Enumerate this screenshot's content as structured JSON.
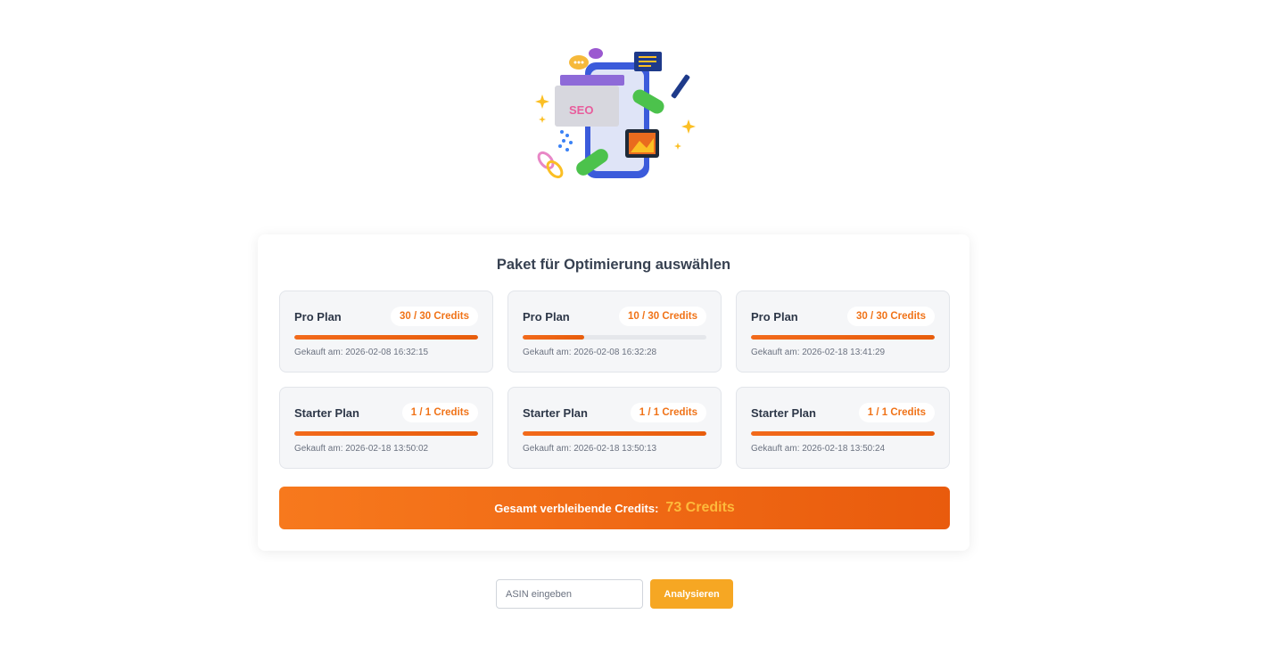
{
  "hero": {
    "illustration_text": "SEO"
  },
  "panel": {
    "title": "Paket für Optimierung auswählen",
    "plans": [
      {
        "name": "Pro Plan",
        "credits": "30 / 30 Credits",
        "remaining_fraction": 1.0,
        "purchased": "Gekauft am: 2026-02-08 16:32:15"
      },
      {
        "name": "Pro Plan",
        "credits": "10 / 30 Credits",
        "remaining_fraction": 0.3333,
        "purchased": "Gekauft am: 2026-02-08 16:32:28"
      },
      {
        "name": "Pro Plan",
        "credits": "30 / 30 Credits",
        "remaining_fraction": 1.0,
        "purchased": "Gekauft am: 2026-02-18 13:41:29"
      },
      {
        "name": "Starter Plan",
        "credits": "1 / 1 Credits",
        "remaining_fraction": 1.0,
        "purchased": "Gekauft am: 2026-02-18 13:50:02"
      },
      {
        "name": "Starter Plan",
        "credits": "1 / 1 Credits",
        "remaining_fraction": 1.0,
        "purchased": "Gekauft am: 2026-02-18 13:50:13"
      },
      {
        "name": "Starter Plan",
        "credits": "1 / 1 Credits",
        "remaining_fraction": 1.0,
        "purchased": "Gekauft am: 2026-02-18 13:50:24"
      }
    ],
    "total_label": "Gesamt verbleibende Credits:",
    "total_value": "73 Credits"
  },
  "search": {
    "placeholder": "ASIN eingeben",
    "value": "",
    "button_label": "Analysieren"
  },
  "colors": {
    "accent_orange": "#f07318",
    "total_value_color": "#fdba3b",
    "button_color": "#f6a723"
  }
}
